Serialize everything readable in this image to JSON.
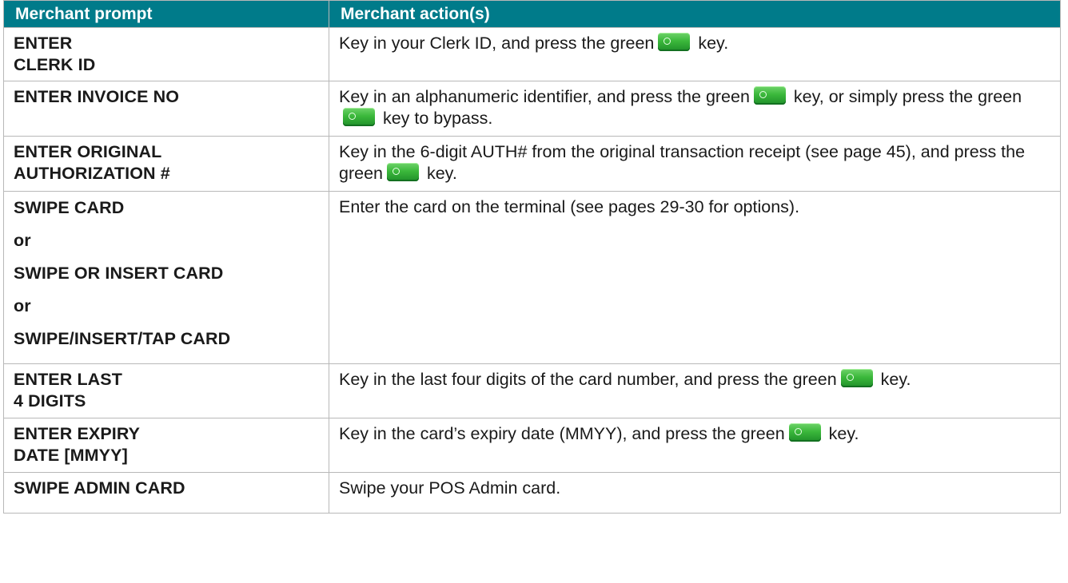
{
  "header": {
    "col1": "Merchant prompt",
    "col2": "Merchant action(s)"
  },
  "colors": {
    "header_bg": "#007b8a",
    "key_green": "#3bb83b"
  },
  "rows": [
    {
      "prompt_lines": [
        "ENTER",
        "CLERK ID"
      ],
      "action_parts": [
        "Key in your Clerk ID, and press the green",
        "key."
      ]
    },
    {
      "prompt_lines": [
        "ENTER INVOICE NO"
      ],
      "action_parts": [
        "Key in an alphanumeric identifier, and press the green",
        "key, or simply press the green",
        "key to bypass."
      ]
    },
    {
      "prompt_lines": [
        "ENTER ORIGINAL",
        "AUTHORIZATION #"
      ],
      "action_parts": [
        "Key in the 6-digit AUTH# from the original transaction receipt (see page 45), and press the green",
        "key."
      ]
    },
    {
      "prompt_lines": [
        "SWIPE CARD",
        "or",
        "SWIPE OR INSERT CARD",
        "or",
        "SWIPE/INSERT/TAP CARD"
      ],
      "action_parts": [
        "Enter the card on the terminal (see pages 29-30 for options)."
      ]
    },
    {
      "prompt_lines": [
        "ENTER LAST",
        "4 DIGITS"
      ],
      "action_parts": [
        "Key in the last four digits of the card number, and press the green",
        "key."
      ]
    },
    {
      "prompt_lines": [
        "ENTER EXPIRY",
        "DATE [MMYY]"
      ],
      "action_parts": [
        "Key in the card’s expiry date (MMYY), and press the green",
        "key."
      ]
    },
    {
      "prompt_lines": [
        "SWIPE ADMIN CARD"
      ],
      "action_parts": [
        "Swipe your POS Admin card."
      ]
    }
  ],
  "icons": {
    "key": "green-enter-key-icon"
  }
}
